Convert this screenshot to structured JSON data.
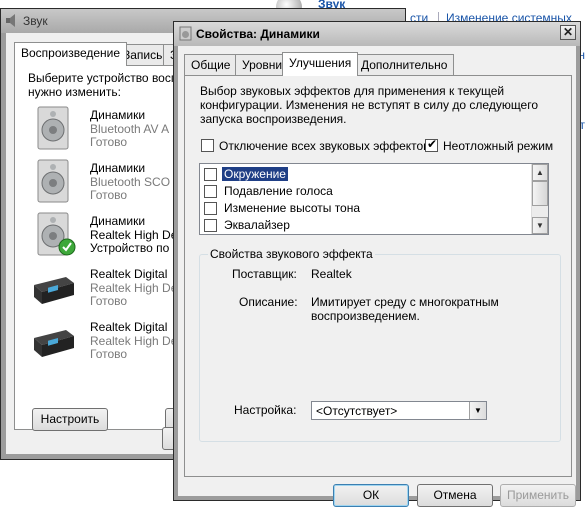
{
  "background": {
    "title": "Звук",
    "link1": "сти",
    "link2": "Изменение системных звуков",
    "frag1": "н",
    "frag2": "т"
  },
  "sound_window": {
    "title": "Звук",
    "tabs": [
      "Воспроизведение",
      "Запись",
      "З"
    ],
    "instruction_line1": "Выберите устройство воспр",
    "instruction_line2": "нужно изменить:",
    "devices": [
      {
        "name": "Динамики",
        "sub": "Bluetooth AV A",
        "status": "Готово",
        "icon": "speaker-icon"
      },
      {
        "name": "Динамики",
        "sub": "Bluetooth SCO",
        "status": "Готово",
        "icon": "speaker-icon"
      },
      {
        "name": "Динамики",
        "sub": "Realtek High De",
        "status": "Устройство по",
        "icon": "speaker-default-icon"
      },
      {
        "name": "Realtek Digital",
        "sub": "Realtek High De",
        "status": "Готово",
        "icon": "digital-output-icon"
      },
      {
        "name": "Realtek Digital",
        "sub": "Realtek High De",
        "status": "Готово",
        "icon": "digital-output-icon"
      }
    ],
    "configure_button": "Настроить"
  },
  "properties_window": {
    "title": "Свойства: Динамики",
    "close_label": "✕",
    "tabs": [
      "Общие",
      "Уровни",
      "Улучшения",
      "Дополнительно"
    ],
    "active_tab": "Улучшения",
    "description_line1": "Выбор звуковых эффектов для применения к текущей",
    "description_line2": "конфигурации. Изменения не вступят в силу до следующего",
    "description_line3": "запуска воспроизведения.",
    "disable_all_label": "Отключение всех звуковых эффектов",
    "disable_all_checked": false,
    "immediate_mode_label": "Неотложный режим",
    "immediate_mode_checked": true,
    "effects": [
      {
        "label": "Окружение",
        "checked": false,
        "selected": true
      },
      {
        "label": "Подавление голоса",
        "checked": false,
        "selected": false
      },
      {
        "label": "Изменение высоты тона",
        "checked": false,
        "selected": false
      },
      {
        "label": "Эквалайзер",
        "checked": false,
        "selected": false
      }
    ],
    "effect_properties_title": "Свойства звукового эффекта",
    "provider_label": "Поставщик:",
    "provider_value": "Realtek",
    "description_label": "Описание:",
    "description_value_line1": "Имитирует среду с многократным",
    "description_value_line2": "воспроизведением.",
    "setting_label": "Настройка:",
    "setting_value": "<Отсутствует>",
    "ok_button": "ОК",
    "cancel_button": "Отмена",
    "apply_button": "Применить"
  }
}
